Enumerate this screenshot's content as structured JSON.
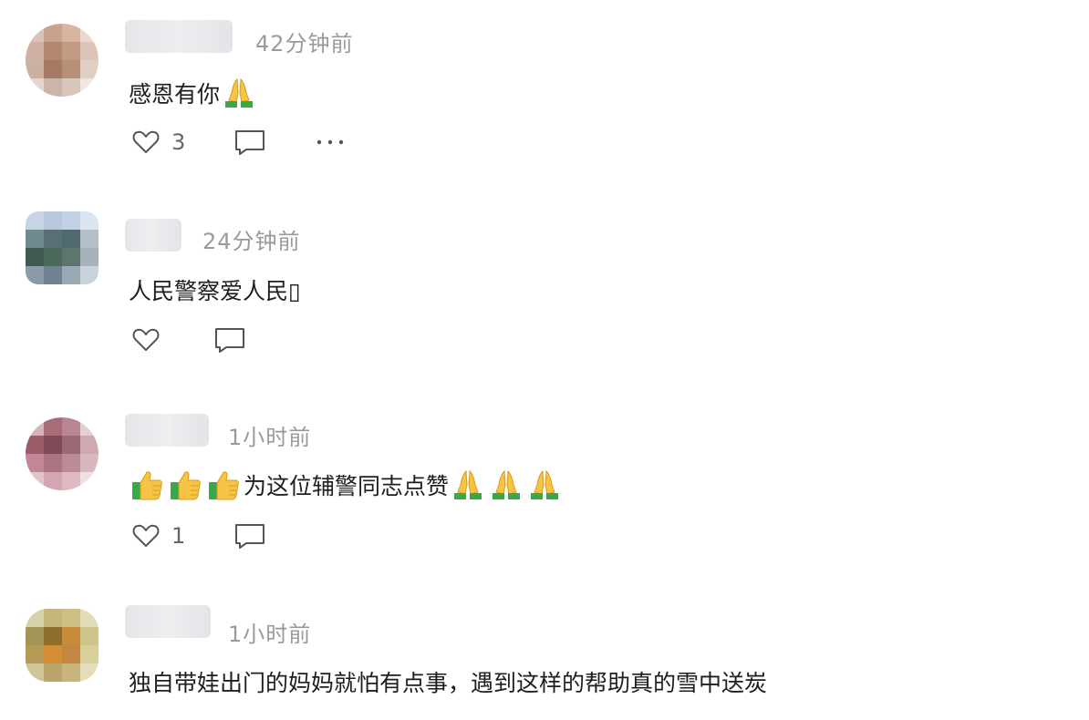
{
  "comments": [
    {
      "time": "42分钟前",
      "text": "感恩有你",
      "emojis_after": [
        "pray"
      ],
      "likes": "3",
      "show_more": true
    },
    {
      "time": "24分钟前",
      "text": "人民警察爱人民▯",
      "emojis_after": [],
      "likes": "",
      "show_more": false
    },
    {
      "time": "1小时前",
      "text": "为这位辅警同志点赞",
      "emojis_before": [
        "thumbs-up",
        "thumbs-up",
        "thumbs-up"
      ],
      "emojis_after": [
        "pray",
        "pray",
        "pray"
      ],
      "likes": "1",
      "show_more": false
    },
    {
      "time": "1小时前",
      "text": "独自带娃出门的妈妈就怕有点事，遇到这样的帮助真的雪中送炭",
      "emojis_after": [],
      "likes": "",
      "show_more": false
    }
  ],
  "icons": {
    "like": "heart-outline-icon",
    "reply": "speech-bubble-icon",
    "more": "ellipsis-icon",
    "pray": "folded-hands-emoji",
    "thumbs_up": "thumbs-up-emoji"
  },
  "colors": {
    "text": "#1e1e1e",
    "meta": "#9a9a9a",
    "icon": "#555555"
  }
}
